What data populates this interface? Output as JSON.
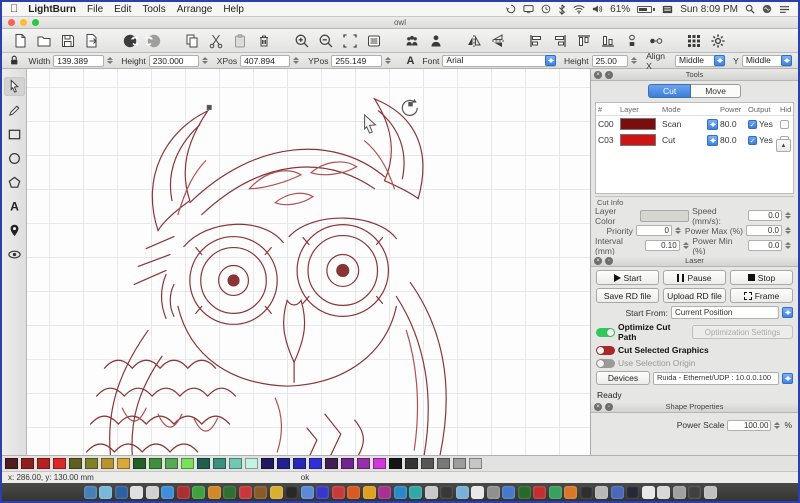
{
  "menubar": {
    "apple": "",
    "items": [
      "LightBurn",
      "File",
      "Edit",
      "Tools",
      "Arrange",
      "Help"
    ],
    "battery_percent": "61%",
    "clock": "Sun 8:09 PM"
  },
  "window": {
    "title": "owl"
  },
  "toolbar_icon_groups": [
    [
      "file-new",
      "folder-open",
      "save",
      "export"
    ],
    [
      "undo",
      "redo"
    ],
    [
      "copy",
      "cut",
      "paste",
      "delete"
    ],
    [
      "zoom-in",
      "zoom-out",
      "frame-select",
      "preview"
    ],
    [
      "group",
      "person"
    ],
    [
      "flip-horizontal",
      "flip-vertical"
    ],
    [
      "align-left",
      "align-right",
      "align-top",
      "align-bottom",
      "distribute-v",
      "distribute-h"
    ],
    [
      "grid-array",
      "settings-gear"
    ]
  ],
  "left_tools": [
    "select",
    "draw",
    "rectangle",
    "ellipse",
    "polygon",
    "text",
    "position",
    "eye"
  ],
  "numeric_toolbar": {
    "width_label": "Width",
    "width_value": "139.389",
    "height_label": "Height",
    "height_value": "230.000",
    "xpos_label": "XPos",
    "xpos_value": "407.894",
    "ypos_label": "YPos",
    "ypos_value": "255.149",
    "font_label": "Font",
    "font_value": "Arial",
    "font_height_label": "Height",
    "font_height_value": "25.00",
    "align_x_label": "Align X",
    "align_x_value": "Middle",
    "align_y_label": "Y",
    "align_y_value": "Middle"
  },
  "cuts_panel": {
    "title": "Tools",
    "tab_cut": "Cut",
    "tab_move": "Move",
    "columns": [
      "#",
      "Layer",
      "Mode",
      "Power",
      "Output",
      "Hid"
    ],
    "rows": [
      {
        "id": "C00",
        "color": "#7a0e0e",
        "mode": "Scan",
        "power": "80.0",
        "output": "Yes",
        "output_checked": true,
        "hide_checked": false
      },
      {
        "id": "C03",
        "color": "#cc1414",
        "mode": "Cut",
        "power": "80.0",
        "output": "Yes",
        "output_checked": true,
        "hide_checked": false
      }
    ],
    "cut_info": {
      "title": "Cut Info",
      "layer_color_label": "Layer Color",
      "speed_label": "Speed  (mm/s):",
      "speed_value": "0.0",
      "priority_label": "Priority",
      "priority_value": "0",
      "power_max_label": "Power Max (%)",
      "power_max_value": "0.0",
      "interval_label": "Interval (mm)",
      "interval_value": "0.10",
      "power_min_label": "Power Min (%)",
      "power_min_value": "0.0"
    }
  },
  "laser_panel": {
    "title": "Laser",
    "start_label": "Start",
    "pause_label": "Pause",
    "stop_label": "Stop",
    "save_rd_label": "Save RD file",
    "upload_rd_label": "Upload RD file",
    "frame_label": "Frame",
    "start_from_label": "Start From:",
    "start_from_value": "Current Position",
    "optimize_label": "Optimize Cut Path",
    "optimization_settings_label": "Optimization Settings",
    "cut_selected_label": "Cut Selected Graphics",
    "use_origin_label": "Use Selection Origin",
    "devices_label": "Devices",
    "device_value": "Ruida - Ethernet/UDP : 10.0.0.100",
    "status": "Ready"
  },
  "shape_panel": {
    "title": "Shape Properties",
    "power_scale_label": "Power Scale",
    "power_scale_value": "100.00",
    "unit": "%"
  },
  "statusbar": {
    "coords": "x: 286.00, y: 130.00 mm",
    "message": "ok"
  },
  "palette_colors": [
    "#4f1d1d",
    "#8f1f1f",
    "#b52222",
    "#d92828",
    "#5f5f22",
    "#808028",
    "#b8922e",
    "#d9a83a",
    "#265f26",
    "#3f8f3f",
    "#58a858",
    "#7ce05c",
    "#1f5f50",
    "#3a8f7e",
    "#70c8b4",
    "#c2f2e4",
    "#1c1c5f",
    "#22228f",
    "#2828b5",
    "#3030d9",
    "#402052",
    "#6f2490",
    "#9530a8",
    "#cc3ad9",
    "#151515",
    "#343434",
    "#565656",
    "#787878",
    "#9c9c9c",
    "#c6c6c6"
  ],
  "dock_colors": [
    "#4a7fb5",
    "#7ab8d8",
    "#2f5f9e",
    "#e0e0e0",
    "#d0d0d0",
    "#3f8fd8",
    "#a83030",
    "#3fa03f",
    "#d08828",
    "#2f6f2f",
    "#c83838",
    "#8a5a28",
    "#d8b030",
    "#282828",
    "#5a8ad8",
    "#3838c8",
    "#c83a3a",
    "#d85a20",
    "#e0a020",
    "#a83090",
    "#2a8ac8",
    "#30a8a8",
    "#c8c8c8",
    "#383838",
    "#78b0d8",
    "#e8e8e8",
    "#909090",
    "#4878c8",
    "#286828",
    "#c03030",
    "#38a060",
    "#d87828",
    "#303030",
    "#b8b8b8",
    "#4868b8",
    "#282838",
    "#e8e8e8",
    "#d8d8d8",
    "#a0a0a0",
    "#404040",
    "#c0c0c0"
  ],
  "canvas": {
    "drawing": "owl-line-art",
    "stroke_dark": "#8a3535",
    "stroke_light": "#b05050"
  }
}
